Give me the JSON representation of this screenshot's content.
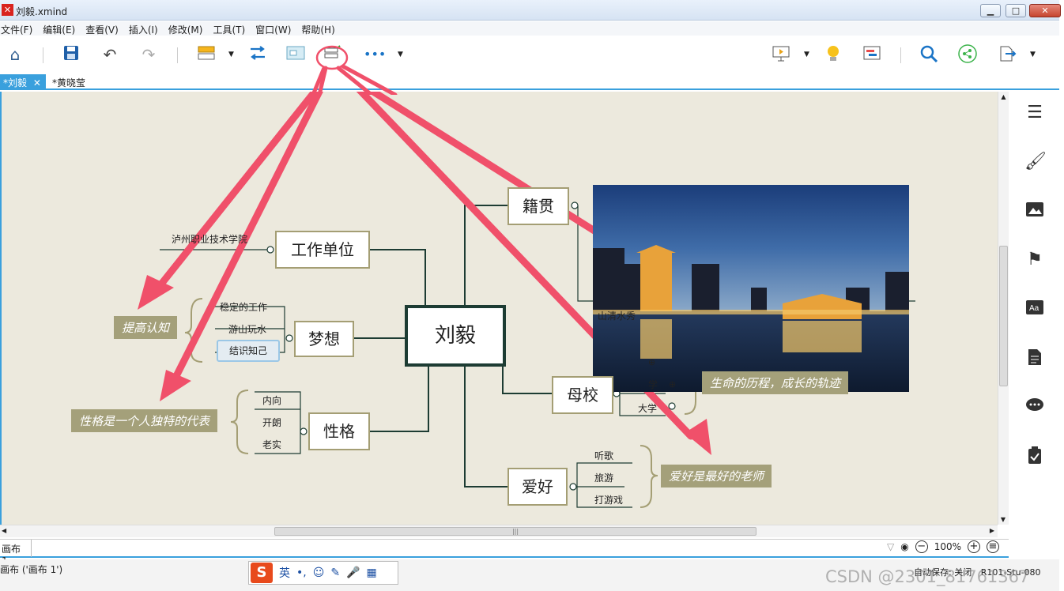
{
  "window": {
    "title": "刘毅.xmind",
    "controls": {
      "minimize": "▁",
      "maximize": "□",
      "close": "✕"
    }
  },
  "menu": [
    "文件(F)",
    "编辑(E)",
    "查看(V)",
    "插入(I)",
    "修改(M)",
    "工具(T)",
    "窗口(W)",
    "帮助(H)"
  ],
  "toolbar": {
    "icons": [
      "home-icon",
      "save-icon",
      "undo-icon",
      "redo-icon",
      "topic-icon",
      "relationship-icon",
      "summary-icon",
      "boundary-icon",
      "more-icon",
      "presentation-icon",
      "brainstorm-icon",
      "gantt-icon",
      "search-icon",
      "share-icon",
      "export-icon"
    ],
    "more_label": "•••"
  },
  "tabs": [
    {
      "label": "*刘毅",
      "close": "✕",
      "active": true
    },
    {
      "label": "*黄晓莹",
      "active": false
    }
  ],
  "mindmap": {
    "central": "刘毅",
    "topics": {
      "work": "工作单位",
      "dream": "梦想",
      "personality": "性格",
      "origin": "籍贯",
      "school": "母校",
      "hobby": "爱好"
    },
    "work_sub": "泸州职业技术学院",
    "dream_sub": [
      "稳定的工作",
      "游山玩水",
      "结识知己"
    ],
    "personality_sub": [
      "内向",
      "开朗",
      "老实"
    ],
    "origin_sub": "山清水秀",
    "school_sub": [
      "学",
      "大学"
    ],
    "hobby_sub": [
      "听歌",
      "旅游",
      "打游戏"
    ]
  },
  "callouts": {
    "dream_summary": "提高认知",
    "personality_summary": "性格是一个人独特的代表",
    "school_summary": "生命的历程，成长的轨迹",
    "hobby_summary": "爱好是最好的老师"
  },
  "colors": {
    "accent": "#3aa0dd",
    "canvas": "#ece9dd",
    "topic_border": "#a49e74",
    "central_border": "#1d3c33",
    "callout_bg": "#a4a07a",
    "arrow": "#f0506a"
  },
  "sheet": {
    "tab": "画布 1",
    "zoom": "100%"
  },
  "right_panel_icons": [
    "outline-icon",
    "format-icon",
    "image-icon",
    "marker-icon",
    "style-icon",
    "notes-icon",
    "comment-icon",
    "task-icon"
  ],
  "status": {
    "text": "画布 ('画布 1')",
    "autosave": "自动保存: 关闭",
    "user": "R101-Stu-080",
    "ime": {
      "logo": "S",
      "lang": "英",
      "punct": "•,",
      "emoji": "☺",
      "pen": "✎",
      "mic": "🎤",
      "grid": "▦"
    },
    "watermark": "CSDN @2301_81761367"
  }
}
